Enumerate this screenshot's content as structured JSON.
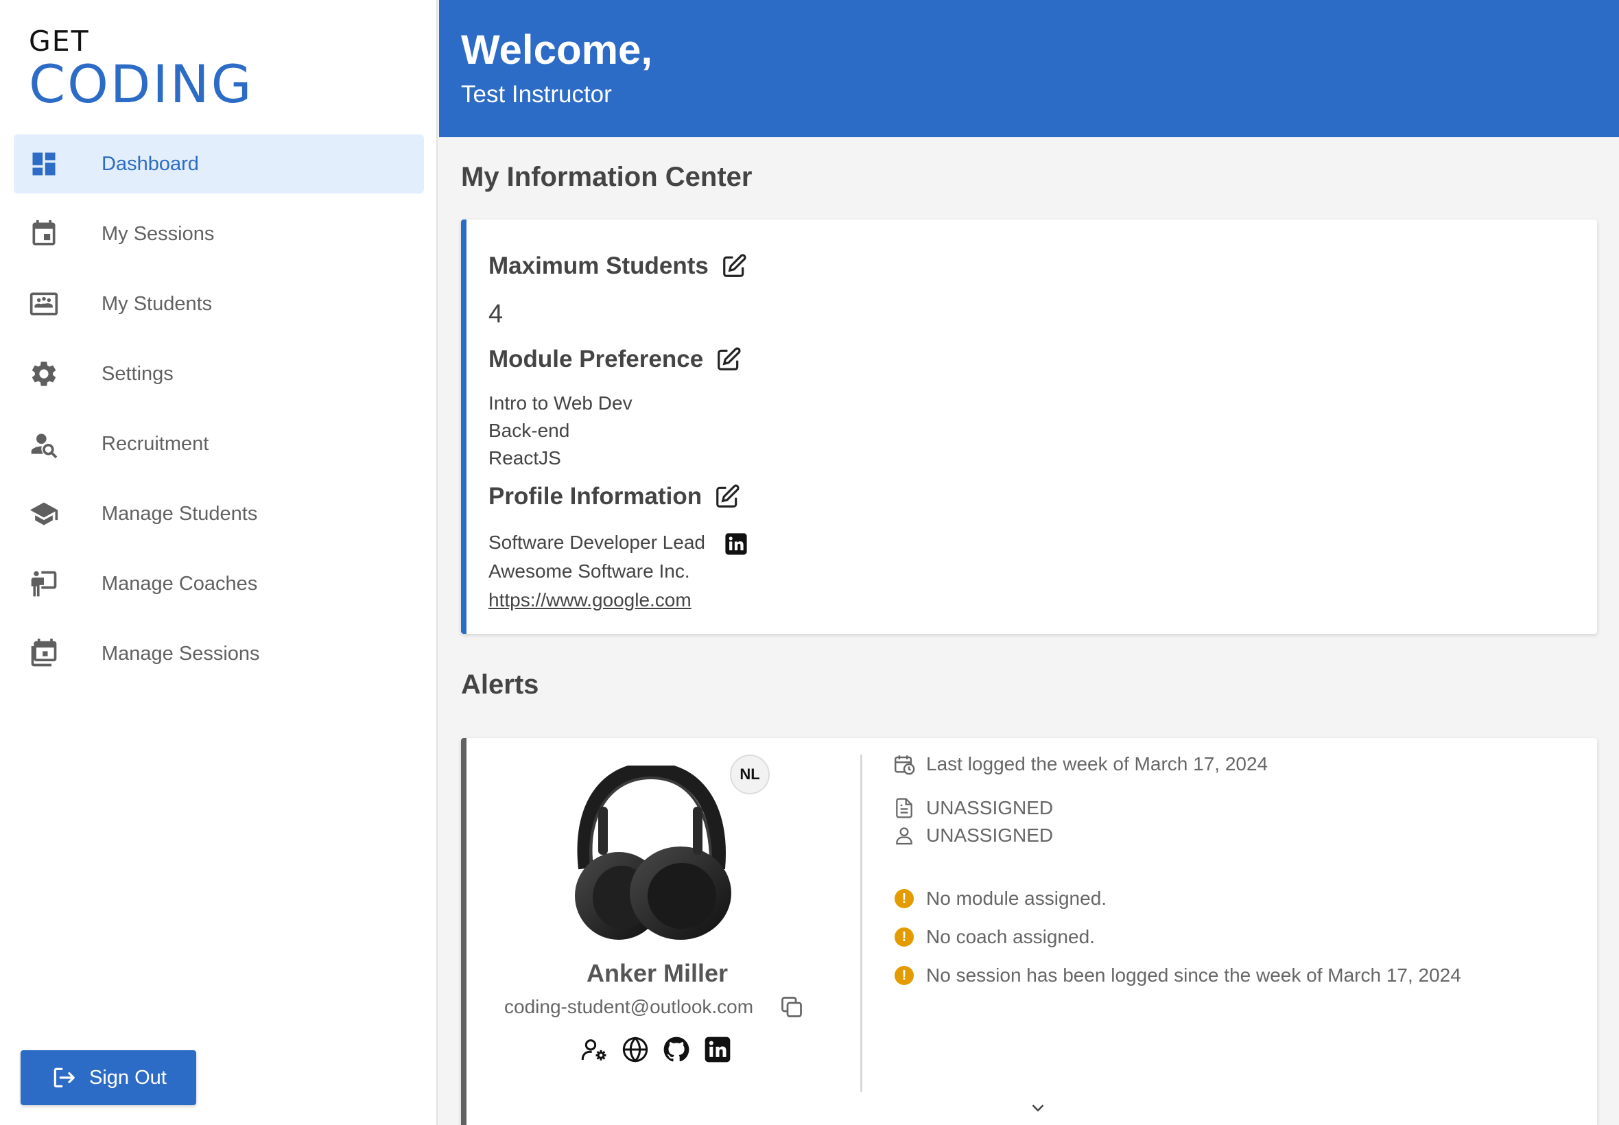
{
  "app": {
    "logo_top": "GET",
    "logo_bottom": "CODING",
    "brand_color": "#2d6cc6"
  },
  "sidebar": {
    "items": [
      {
        "label": "Dashboard",
        "icon": "dashboard-icon",
        "active": true
      },
      {
        "label": "My Sessions",
        "icon": "calendar-icon"
      },
      {
        "label": "My Students",
        "icon": "class-icon"
      },
      {
        "label": "Settings",
        "icon": "gear-icon"
      },
      {
        "label": "Recruitment",
        "icon": "person-search-icon"
      },
      {
        "label": "Manage Students",
        "icon": "graduation-cap-icon"
      },
      {
        "label": "Manage Coaches",
        "icon": "presenter-icon"
      },
      {
        "label": "Manage Sessions",
        "icon": "calendar-stack-icon"
      }
    ],
    "sign_out_label": "Sign Out"
  },
  "header": {
    "welcome": "Welcome,",
    "user_name": "Test Instructor"
  },
  "info_center": {
    "title": "My Information Center",
    "max_students_label": "Maximum Students",
    "max_students_value": "4",
    "module_pref_label": "Module Preference",
    "modules": [
      "Intro to Web Dev",
      "Back-end",
      "ReactJS"
    ],
    "profile_label": "Profile Information",
    "profile_title": "Software Developer Lead",
    "profile_company": "Awesome Software Inc.",
    "profile_url": "https://www.google.com"
  },
  "alerts": {
    "title": "Alerts",
    "student": {
      "initials": "NL",
      "name": "Anker Miller",
      "email": "coding-student@outlook.com"
    },
    "last_logged": "Last logged the week of March 17, 2024",
    "module_status": "UNASSIGNED",
    "coach_status": "UNASSIGNED",
    "warnings": [
      "No module assigned.",
      "No coach assigned.",
      "No session has been logged since the week of March 17, 2024"
    ],
    "warning_color": "#e39b00"
  }
}
